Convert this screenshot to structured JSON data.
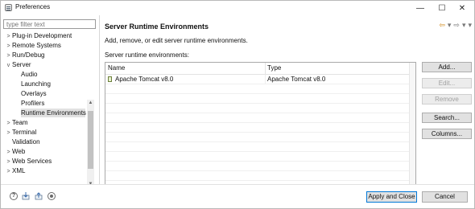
{
  "window": {
    "title": "Preferences",
    "controls": {
      "minimize": "—",
      "maximize": "☐",
      "close": "✕"
    }
  },
  "filter": {
    "placeholder": "type filter text"
  },
  "tree": {
    "items": [
      {
        "label": "Plug-in Development",
        "expander": ">"
      },
      {
        "label": "Remote Systems",
        "expander": ">"
      },
      {
        "label": "Run/Debug",
        "expander": ">"
      },
      {
        "label": "Server",
        "expander": "v"
      },
      {
        "label": "Audio"
      },
      {
        "label": "Launching"
      },
      {
        "label": "Overlays"
      },
      {
        "label": "Profilers"
      },
      {
        "label": "Runtime Environments",
        "selected": true
      },
      {
        "label": "Team",
        "expander": ">"
      },
      {
        "label": "Terminal",
        "expander": ">"
      },
      {
        "label": "Validation"
      },
      {
        "label": "Web",
        "expander": ">"
      },
      {
        "label": "Web Services",
        "expander": ">"
      },
      {
        "label": "XML",
        "expander": ">"
      }
    ],
    "scroll_up": "▲",
    "scroll_down": "▼"
  },
  "page": {
    "title": "Server Runtime Environments",
    "description": "Add, remove, or edit server runtime environments.",
    "list_label": "Server runtime environments:",
    "nav_icons": [
      "back-arrow-icon",
      "dropdown-icon",
      "forward-arrow-icon",
      "dropdown-icon",
      "menu-icon"
    ],
    "nav_glyphs": {
      "back": "⇦",
      "forward": "⇨",
      "dropdown": "▾",
      "menu": "▾"
    }
  },
  "table": {
    "columns": [
      "Name",
      "Type"
    ],
    "rows": [
      {
        "name": "Apache Tomcat v8.0",
        "type": "Apache Tomcat v8.0"
      }
    ]
  },
  "buttons": {
    "add": "Add...",
    "edit": "Edit...",
    "remove": "Remove",
    "search": "Search...",
    "columns": "Columns..."
  },
  "footer": {
    "help_glyph": "?",
    "apply_close": "Apply and Close",
    "cancel": "Cancel"
  }
}
